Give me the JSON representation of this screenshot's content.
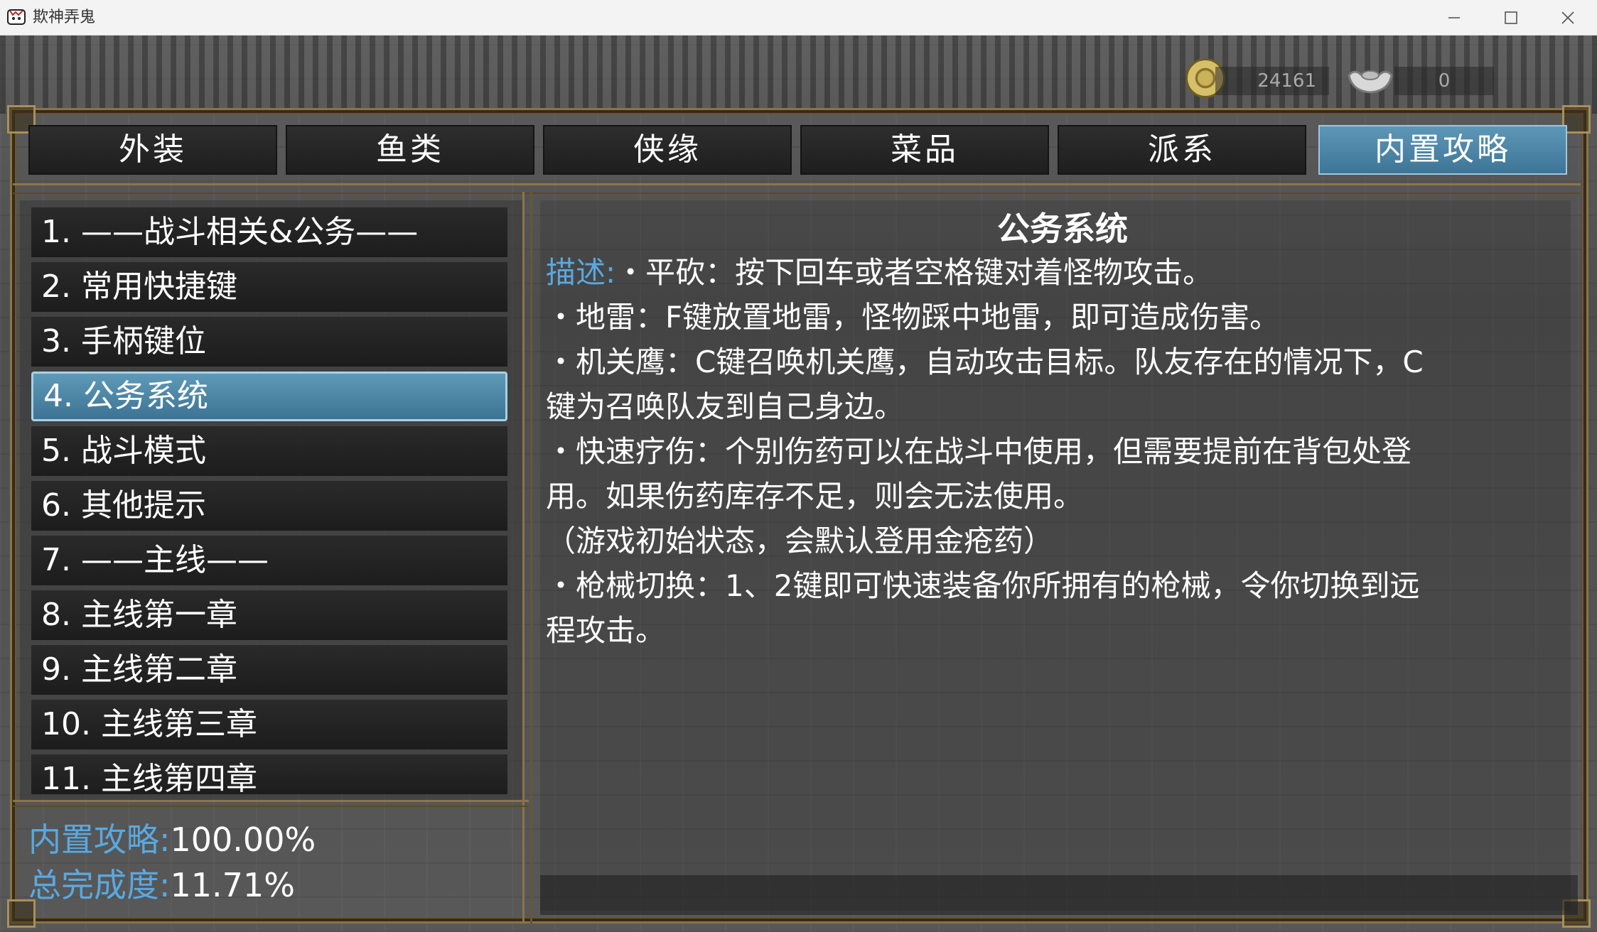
{
  "window": {
    "title": "欺神弄鬼"
  },
  "hud": {
    "coins": "24161",
    "ingots": "0"
  },
  "tabs": [
    {
      "label": "外装",
      "active": false
    },
    {
      "label": "鱼类",
      "active": false
    },
    {
      "label": "侠缘",
      "active": false
    },
    {
      "label": "菜品",
      "active": false
    },
    {
      "label": "派系",
      "active": false
    },
    {
      "label": "内置攻略",
      "active": true
    }
  ],
  "guide_list": [
    {
      "label": "1. ——战斗相关&公务——",
      "selected": false
    },
    {
      "label": "2. 常用快捷键",
      "selected": false
    },
    {
      "label": "3. 手柄键位",
      "selected": false
    },
    {
      "label": "4. 公务系统",
      "selected": true
    },
    {
      "label": "5. 战斗模式",
      "selected": false
    },
    {
      "label": "6. 其他提示",
      "selected": false
    },
    {
      "label": "7. ——主线——",
      "selected": false
    },
    {
      "label": "8. 主线第一章",
      "selected": false
    },
    {
      "label": "9. 主线第二章",
      "selected": false
    },
    {
      "label": "10. 主线第三章",
      "selected": false
    },
    {
      "label": "11. 主线第四章",
      "selected": false
    }
  ],
  "stats": {
    "guide_label": "内置攻略:",
    "guide_value": "100.00%",
    "total_label": "总完成度:",
    "total_value": "11.71%"
  },
  "content": {
    "title": "公务系统",
    "desc_label": "描述:",
    "lines": [
      "・平砍：按下回车或者空格键对着怪物攻击。",
      "・地雷：F键放置地雷，怪物踩中地雷，即可造成伤害。",
      "・机关鹰：C键召唤机关鹰，自动攻击目标。队友存在的情况下，C",
      "键为召唤队友到自己身边。",
      "・快速疗伤：个别伤药可以在战斗中使用，但需要提前在背包处登",
      "用。如果伤药库存不足，则会无法使用。",
      "（游戏初始状态，会默认登用金疮药）",
      "・枪械切换：1、2键即可快速装备你所拥有的枪械，令你切换到远",
      "程攻击。"
    ]
  },
  "colors": {
    "tab_active": "#4a86a8",
    "label_blue": "#5aa8e0",
    "frame_gold": "#8b7446"
  }
}
